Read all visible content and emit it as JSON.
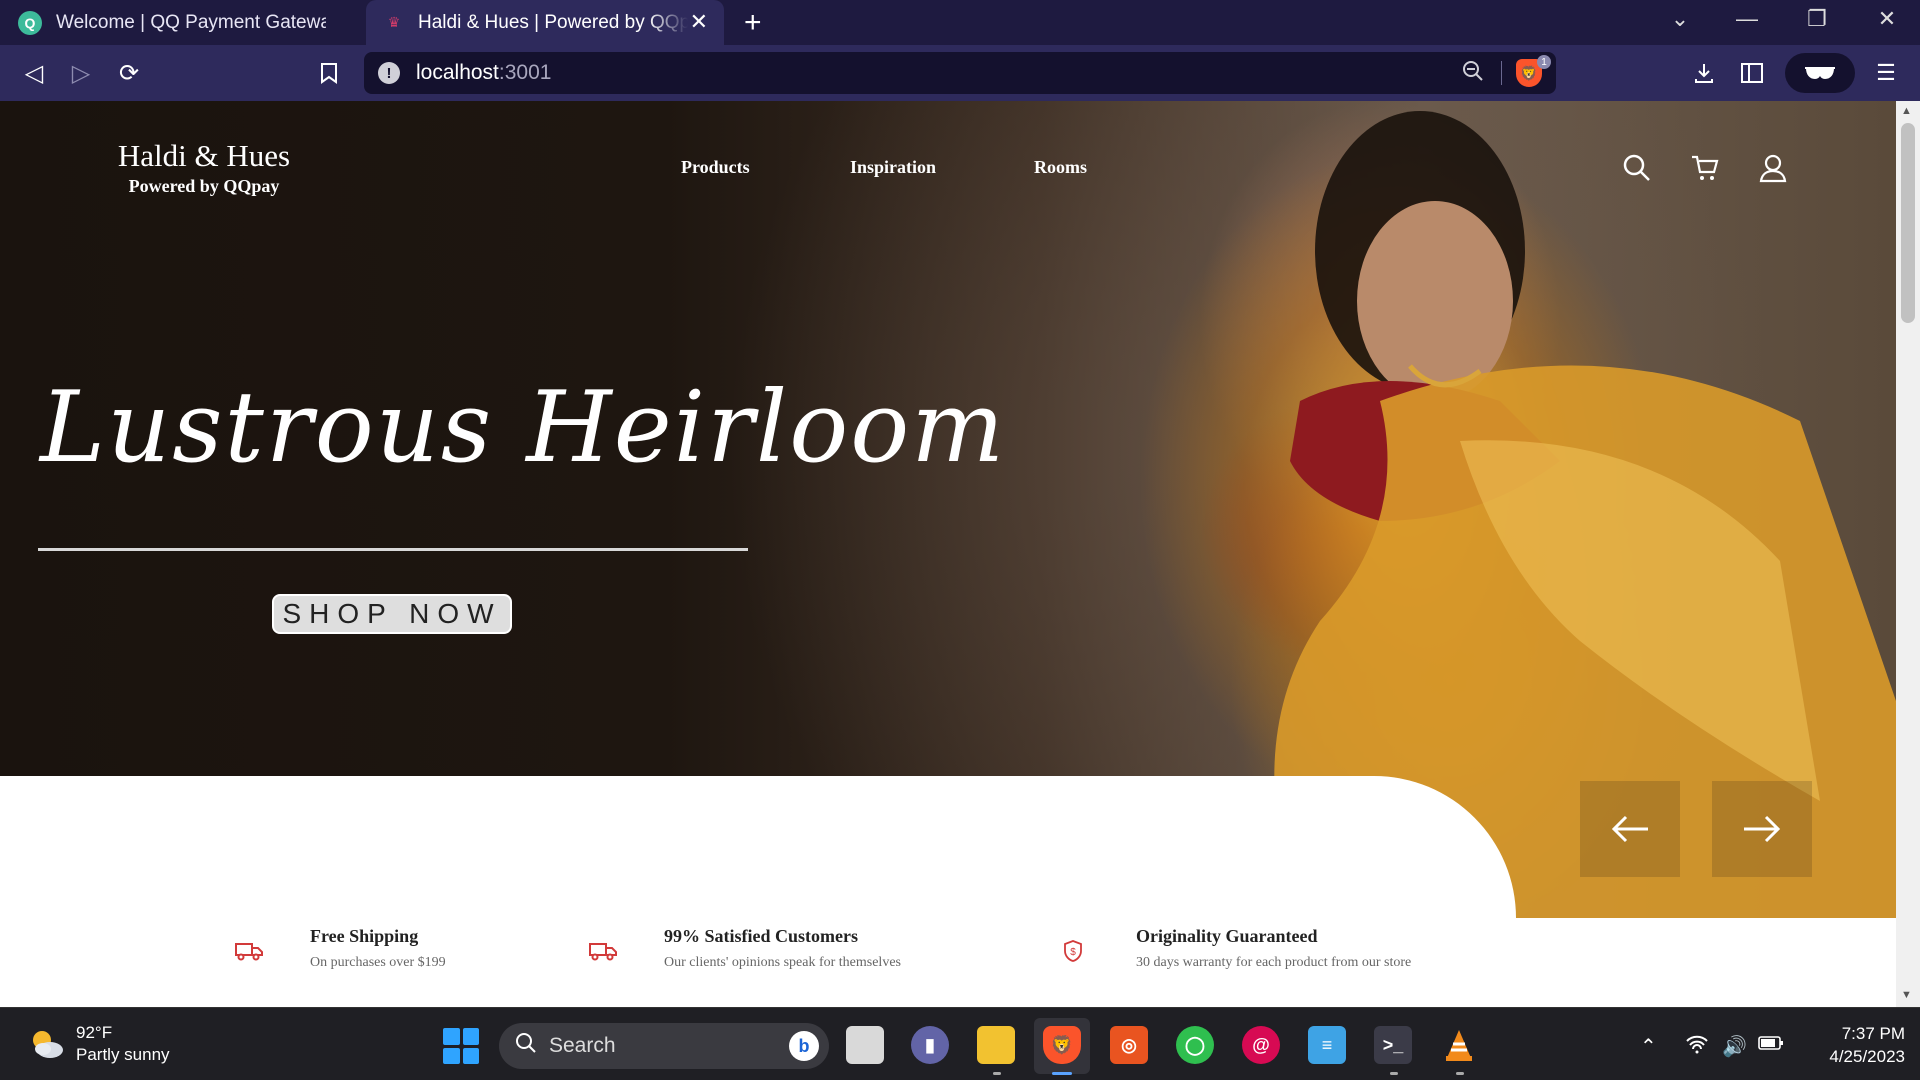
{
  "browser": {
    "tabs": [
      {
        "title": "Welcome | QQ Payment Gateway",
        "favicon": "qq-logo-icon",
        "active": false
      },
      {
        "title": "Haldi & Hues | Powered by QQpay",
        "favicon": "haldi-hues-icon",
        "active": true
      }
    ],
    "url": {
      "host": "localhost",
      "port": ":3001"
    },
    "shield_count": "1"
  },
  "site": {
    "brand_name": "Haldi & Hues",
    "brand_sub": "Powered by QQpay",
    "nav": [
      "Products",
      "Inspiration",
      "Rooms"
    ],
    "header_icons": [
      "search-icon",
      "cart-icon",
      "user-icon"
    ],
    "hero": {
      "title": "Lustrous Heirloom",
      "cta": "SHOP NOW"
    },
    "features": [
      {
        "title": "Free Shipping",
        "subtitle": "On purchases over $199",
        "icon": "truck-icon"
      },
      {
        "title": "99% Satisfied Customers",
        "subtitle": "Our clients' opinions speak for themselves",
        "icon": "truck-icon"
      },
      {
        "title": "Originality Guaranteed",
        "subtitle": "30 days warranty for each product from our store",
        "icon": "shield-dollar-icon"
      }
    ],
    "slider": {
      "prev": "arrow-left-icon",
      "next": "arrow-right-icon"
    }
  },
  "taskbar": {
    "weather": {
      "temp": "92°F",
      "condition": "Partly sunny"
    },
    "search_placeholder": "Search",
    "time": "7:37 PM",
    "date": "4/25/2023"
  },
  "colors": {
    "browser_frame": "#1e1a40",
    "toolbar": "#2e2a5c",
    "feature_icon": "#d23a3a",
    "taskbar": "#1f1f24"
  }
}
